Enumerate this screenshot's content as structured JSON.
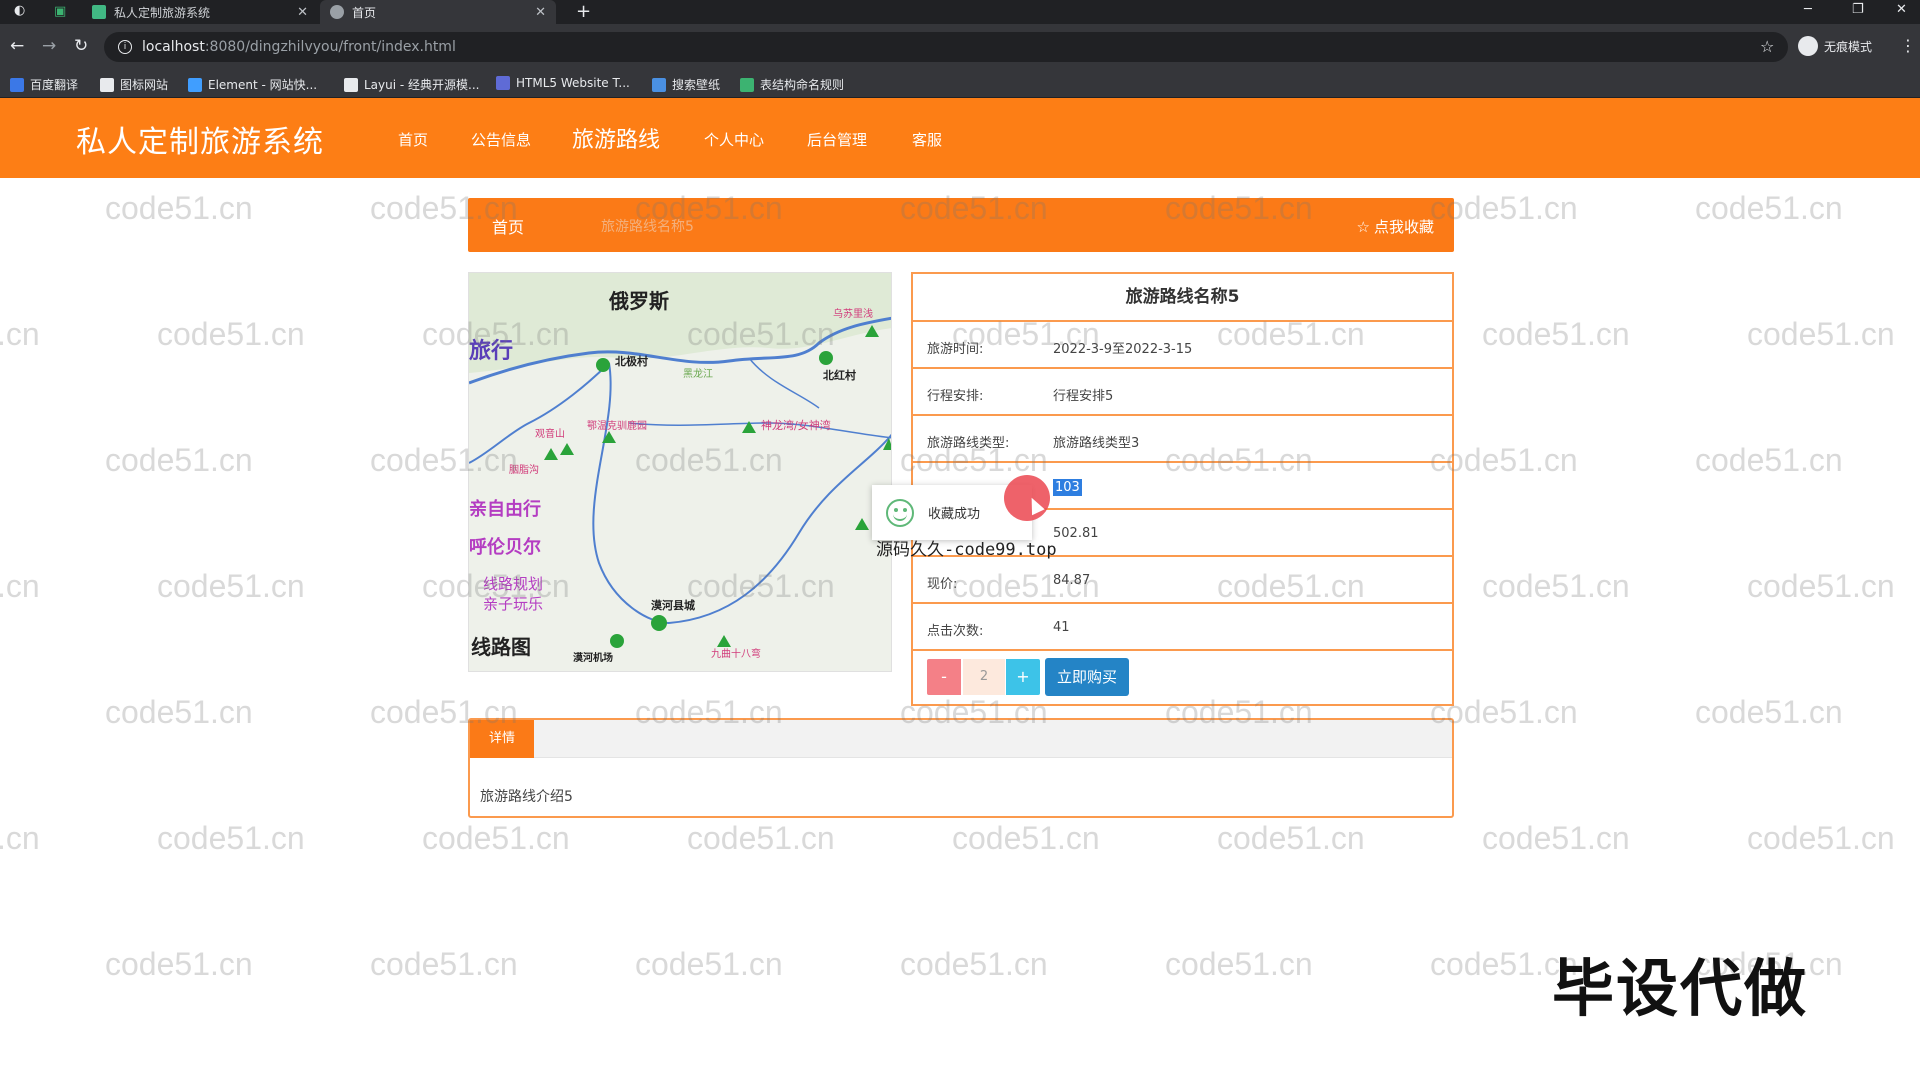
{
  "browser": {
    "tabs": [
      {
        "title": "私人定制旅游系统"
      },
      {
        "title": "首页"
      }
    ],
    "url_host": "localhost",
    "url_path": ":8080/dingzhilvyou/front/index.html",
    "profile_label": "无痕模式",
    "bookmarks": [
      {
        "label": "百度翻译",
        "color": "#3b78e7"
      },
      {
        "label": "图标网站",
        "color": "#e8eaed"
      },
      {
        "label": "Element - 网站快...",
        "color": "#409eff"
      },
      {
        "label": "Layui - 经典开源模...",
        "color": "#e8eaed"
      },
      {
        "label": "HTML5 Website T...",
        "color": "#5f6bd6"
      },
      {
        "label": "搜索壁纸",
        "color": "#4a90e2"
      },
      {
        "label": "表结构命名规则",
        "color": "#3cb371"
      }
    ]
  },
  "site": {
    "title": "私人定制旅游系统",
    "nav": [
      {
        "label": "首页"
      },
      {
        "label": "公告信息"
      },
      {
        "label": "旅游路线"
      },
      {
        "label": "个人中心"
      },
      {
        "label": "后台管理"
      },
      {
        "label": "客服"
      }
    ],
    "accent": "#fd7e15"
  },
  "breadcrumb": {
    "home": "首页",
    "current": "旅游路线名称5",
    "favorite_label": "点我收藏"
  },
  "map": {
    "labels": [
      "俄罗斯",
      "北极村",
      "北红村",
      "乌苏里浅",
      "观音山",
      "鄂温克驯鹿园",
      "神龙湾/女神湾",
      "漠河县城",
      "漠河机场",
      "九曲十八弯",
      "胭脂沟",
      "亲自由行",
      "呼伦贝尔",
      "线路规划",
      "亲子玩乐",
      "线路图",
      "黑龙江"
    ],
    "brand": "旅行"
  },
  "info": {
    "title": "旅游路线名称5",
    "rows": [
      {
        "label": "旅游时间:",
        "value": "2022-3-9至2022-3-15"
      },
      {
        "label": "行程安排:",
        "value": "行程安排5"
      },
      {
        "label": "旅游路线类型:",
        "value": "旅游路线类型3"
      },
      {
        "label": "",
        "value": "103"
      },
      {
        "label": "",
        "value": "502.81"
      },
      {
        "label": "现价:",
        "value": "84.87"
      },
      {
        "label": "点击次数:",
        "value": "41"
      }
    ],
    "quantity": "2",
    "minus_label": "-",
    "plus_label": "+",
    "buy_label": "立即购买"
  },
  "toast": {
    "message": "收藏成功"
  },
  "overlay_text": "源码久久-code99.top",
  "detail": {
    "tab_label": "详情",
    "body": "旅游路线介绍5"
  },
  "watermark_text": "code51.cn",
  "corner_stamp": "毕设代做"
}
